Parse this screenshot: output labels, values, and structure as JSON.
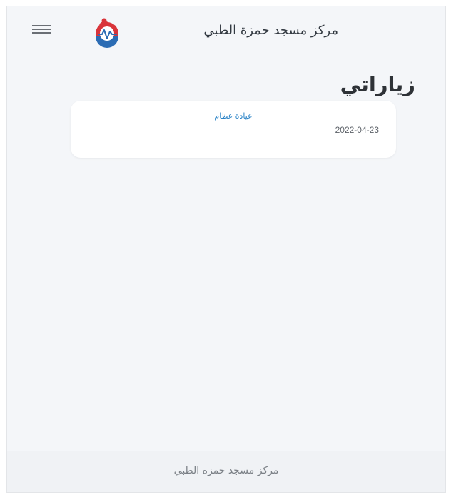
{
  "header": {
    "app_title": "مركز مسجد حمزة الطبي",
    "logo_icon": "heartbeat-logo-icon",
    "menu_icon": "hamburger-menu-icon"
  },
  "page": {
    "title": "زياراتي"
  },
  "visits": [
    {
      "name": "عيادة عظام",
      "date": "2022-04-23"
    }
  ],
  "footer": {
    "text": "مركز مسجد حمزة الطبي"
  },
  "colors": {
    "background": "#f4f6f9",
    "card": "#ffffff",
    "link_blue": "#2a83c7",
    "logo_red": "#d9343a",
    "logo_blue": "#2b6cb4"
  }
}
